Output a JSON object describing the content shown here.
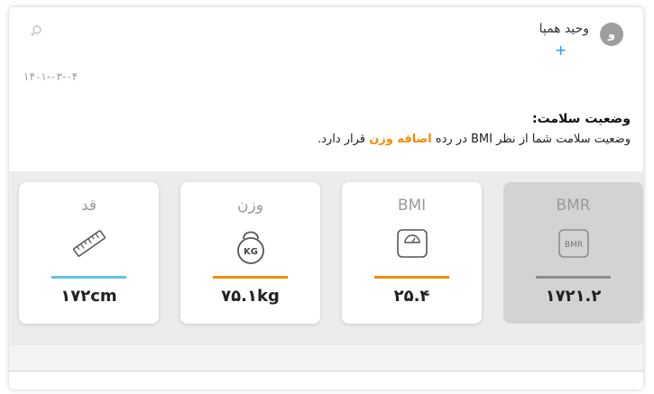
{
  "user": {
    "avatar_letter": "و",
    "name": "وحید همپا",
    "add_label": "+"
  },
  "record": {
    "gender_icon": "female-symbol-icon",
    "date": "۱۴۰۱-۰۳-۰۴"
  },
  "status": {
    "title": "وضعیت سلامت:",
    "text_before": "وضعیت سلامت شما از نظر BMI در رده ",
    "highlight": "اضافه وزن",
    "text_after": " قرار دارد."
  },
  "metrics": [
    {
      "label": "BMR",
      "value": "۱۷۲۱.۲",
      "icon": "bmr-badge-icon",
      "icon_text": "BMR",
      "bar_color": "#8c8c8c",
      "selected": true
    },
    {
      "label": "BMI",
      "value": "۲۵.۴",
      "icon": "bathroom-scale-icon",
      "bar_color": "#f28c00",
      "selected": false
    },
    {
      "label": "وزن",
      "value": "۷۵.۱kg",
      "icon": "kettlebell-kg-icon",
      "icon_text": "KG",
      "bar_color": "#f28c00",
      "selected": false
    },
    {
      "label": "قد",
      "value": "۱۷۲cm",
      "icon": "ruler-icon",
      "bar_color": "#5fc3e8",
      "selected": false
    }
  ],
  "colors": {
    "accent": "#f28c00",
    "plus": "#2196f3",
    "height_bar": "#5fc3e8",
    "bmr_bar": "#8c8c8c"
  }
}
